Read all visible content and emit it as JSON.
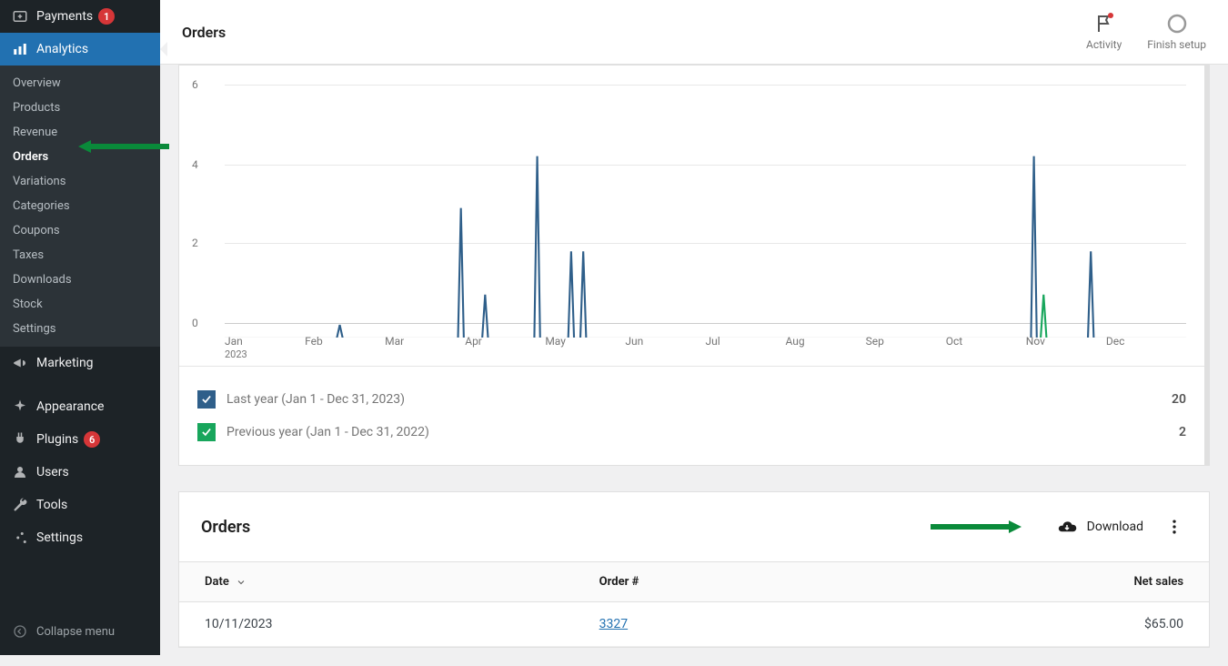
{
  "sidebar": {
    "payments": {
      "label": "Payments",
      "badge": "1"
    },
    "analytics": {
      "label": "Analytics"
    },
    "sub": [
      "Overview",
      "Products",
      "Revenue",
      "Orders",
      "Variations",
      "Categories",
      "Coupons",
      "Taxes",
      "Downloads",
      "Stock",
      "Settings"
    ],
    "activeSub": "Orders",
    "marketing": "Marketing",
    "appearance": "Appearance",
    "plugins": {
      "label": "Plugins",
      "badge": "6"
    },
    "users": "Users",
    "tools": "Tools",
    "settings": "Settings",
    "collapse": "Collapse menu"
  },
  "topbar": {
    "title": "Orders",
    "activity": "Activity",
    "finish": "Finish setup"
  },
  "chart_data": {
    "type": "line",
    "ylim": [
      0,
      6
    ],
    "yticks": [
      0,
      2,
      4,
      6
    ],
    "xticks": [
      "Jan",
      "Feb",
      "Mar",
      "Apr",
      "May",
      "Jun",
      "Jul",
      "Aug",
      "Sep",
      "Oct",
      "Nov",
      "Dec"
    ],
    "year_sub": "2023",
    "series": [
      {
        "name": "Last year (Jan 1 - Dec 31, 2023)",
        "color": "#2f5f8a",
        "total": 20,
        "spikes": [
          {
            "x": 0.095,
            "value": 0.3
          },
          {
            "x": 0.195,
            "value": 3
          },
          {
            "x": 0.215,
            "value": 1
          },
          {
            "x": 0.258,
            "value": 4.2
          },
          {
            "x": 0.286,
            "value": 2
          },
          {
            "x": 0.296,
            "value": 2
          },
          {
            "x": 0.668,
            "value": 4.2
          },
          {
            "x": 0.715,
            "value": 2
          }
        ]
      },
      {
        "name": "Previous year (Jan 1 - Dec 31, 2022)",
        "color": "#18a65c",
        "total": 2,
        "spikes": [
          {
            "x": 0.676,
            "value": 1
          },
          {
            "x": 0.805,
            "value": 1
          }
        ]
      }
    ]
  },
  "legend": {
    "row1": "Last year (Jan 1 - Dec 31, 2023)",
    "val1": "20",
    "row2": "Previous year (Jan 1 - Dec 31, 2022)",
    "val2": "2"
  },
  "orders": {
    "title": "Orders",
    "download": "Download",
    "columns": {
      "date": "Date",
      "order": "Order #",
      "net": "Net sales"
    },
    "rows": [
      {
        "date": "10/11/2023",
        "order": "3327",
        "net": "$65.00"
      }
    ]
  }
}
